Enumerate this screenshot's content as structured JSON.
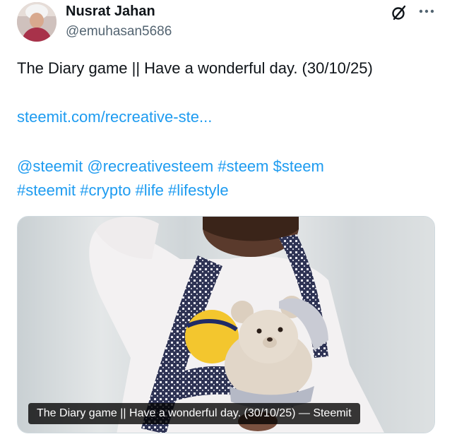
{
  "author": {
    "name": "Nusrat Jahan",
    "handle": "@emuhasan5686"
  },
  "tweet": {
    "text": "The Diary game || Have a wonderful day. (30/10/25)",
    "link": "steemit.com/recreative-ste...",
    "line1": [
      "@steemit",
      "@recreativesteem",
      "#steem",
      "$steem"
    ],
    "line2": [
      "#steemit",
      "#crypto",
      "#life",
      "#lifestyle"
    ]
  },
  "media": {
    "caption": "The Diary game || Have a wonderful day. (30/10/25) — Steemit"
  },
  "icons": {
    "grok": "grok-icon",
    "more": "more-icon"
  },
  "colors": {
    "link": "#1d9bf0",
    "text": "#0f1419",
    "secondary": "#536471"
  }
}
